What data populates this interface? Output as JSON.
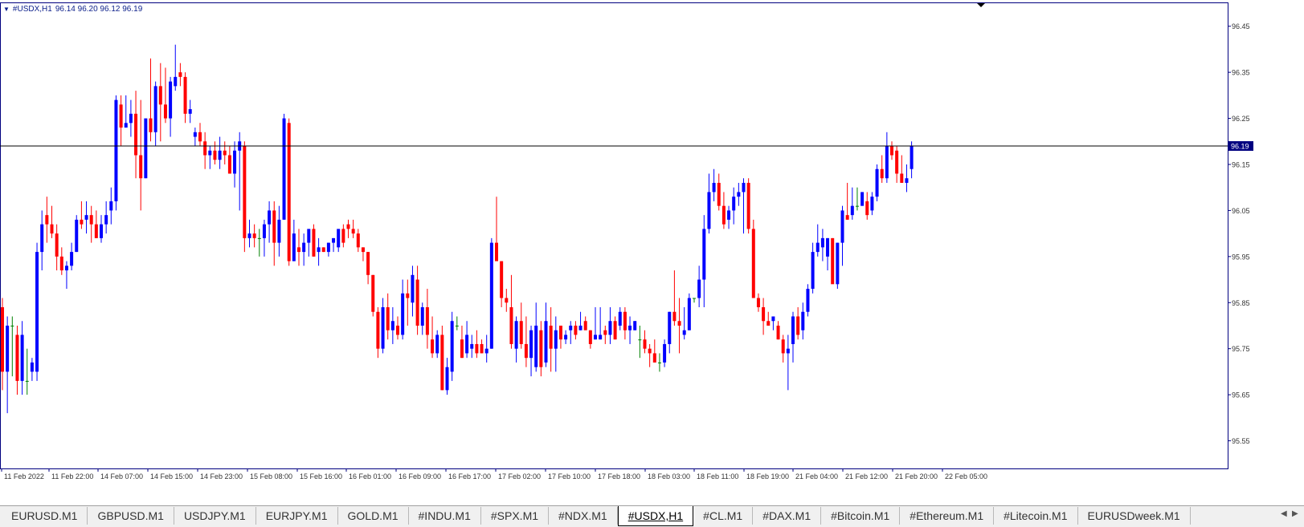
{
  "header": {
    "symbol": "#USDX,H1",
    "ohlc": "96.14 96.20 96.12 96.19"
  },
  "colors": {
    "bull": "#0000ff",
    "bear": "#ff0000",
    "doji": "#008000",
    "axis": "#000080",
    "current_price_line": "#000000"
  },
  "chart_data": {
    "type": "candlestick",
    "y_axis": {
      "range": [
        95.49,
        96.5
      ],
      "ticks": [
        "96.45",
        "96.35",
        "96.25",
        "96.15",
        "96.05",
        "95.95",
        "95.85",
        "95.75",
        "95.65",
        "95.55"
      ]
    },
    "current_price": "96.19",
    "x_labels": [
      "11 Feb 2022",
      "11 Feb 22:00",
      "14 Feb 07:00",
      "14 Feb 15:00",
      "14 Feb 23:00",
      "15 Feb 08:00",
      "15 Feb 16:00",
      "16 Feb 01:00",
      "16 Feb 09:00",
      "16 Feb 17:00",
      "17 Feb 02:00",
      "17 Feb 10:00",
      "17 Feb 18:00",
      "18 Feb 03:00",
      "18 Feb 11:00",
      "18 Feb 19:00",
      "21 Feb 04:00",
      "21 Feb 12:00",
      "21 Feb 20:00",
      "22 Feb 05:00"
    ],
    "candles": [
      [
        95.84,
        95.86,
        95.66,
        95.7
      ],
      [
        95.7,
        95.82,
        95.61,
        95.8
      ],
      [
        95.8,
        95.82,
        95.69,
        95.8
      ],
      [
        95.78,
        95.8,
        95.65,
        95.68
      ],
      [
        95.68,
        95.81,
        95.65,
        95.78
      ],
      [
        95.68,
        95.75,
        95.65,
        95.68
      ],
      [
        95.7,
        95.73,
        95.68,
        95.72
      ],
      [
        95.7,
        95.98,
        95.68,
        95.96
      ],
      [
        95.96,
        96.05,
        95.92,
        96.02
      ],
      [
        96.04,
        96.08,
        95.98,
        96.02
      ],
      [
        96.02,
        96.06,
        95.99,
        96.0
      ],
      [
        96.0,
        96.02,
        95.92,
        95.95
      ],
      [
        95.95,
        95.97,
        95.91,
        95.92
      ],
      [
        95.92,
        95.94,
        95.88,
        95.93
      ],
      [
        95.93,
        95.98,
        95.92,
        95.96
      ],
      [
        95.96,
        96.04,
        95.96,
        96.03
      ],
      [
        96.03,
        96.07,
        96.01,
        96.02
      ],
      [
        96.03,
        96.07,
        96.0,
        96.04
      ],
      [
        96.04,
        96.06,
        95.98,
        96.02
      ],
      [
        96.02,
        96.05,
        95.99,
        95.99
      ],
      [
        95.99,
        96.04,
        95.98,
        96.02
      ],
      [
        96.02,
        96.07,
        96.0,
        96.04
      ],
      [
        96.05,
        96.1,
        96.02,
        96.07
      ],
      [
        96.07,
        96.3,
        96.05,
        96.29
      ],
      [
        96.28,
        96.3,
        96.19,
        96.23
      ],
      [
        96.23,
        96.3,
        96.23,
        96.24
      ],
      [
        96.24,
        96.29,
        96.21,
        96.26
      ],
      [
        96.26,
        96.31,
        96.12,
        96.17
      ],
      [
        96.17,
        96.29,
        96.05,
        96.12
      ],
      [
        96.12,
        96.24,
        96.12,
        96.25
      ],
      [
        96.25,
        96.38,
        96.2,
        96.22
      ],
      [
        96.22,
        96.33,
        96.19,
        96.32
      ],
      [
        96.32,
        96.37,
        96.2,
        96.28
      ],
      [
        96.28,
        96.36,
        96.24,
        96.25
      ],
      [
        96.25,
        96.34,
        96.21,
        96.33
      ],
      [
        96.32,
        96.41,
        96.31,
        96.34
      ],
      [
        96.35,
        96.37,
        96.32,
        96.34
      ],
      [
        96.34,
        96.35,
        96.24,
        96.26
      ],
      [
        96.26,
        96.29,
        96.24,
        96.27
      ],
      [
        96.21,
        96.23,
        96.19,
        96.22
      ],
      [
        96.22,
        96.24,
        96.19,
        96.2
      ],
      [
        96.2,
        96.22,
        96.14,
        96.17
      ],
      [
        96.17,
        96.19,
        96.14,
        96.18
      ],
      [
        96.18,
        96.2,
        96.15,
        96.16
      ],
      [
        96.16,
        96.21,
        96.14,
        96.18
      ],
      [
        96.18,
        96.2,
        96.15,
        96.17
      ],
      [
        96.17,
        96.19,
        96.13,
        96.13
      ],
      [
        96.13,
        96.2,
        96.1,
        96.18
      ],
      [
        96.18,
        96.22,
        96.05,
        96.2
      ],
      [
        96.19,
        96.2,
        95.96,
        95.99
      ],
      [
        95.99,
        96.03,
        95.97,
        96.0
      ],
      [
        96.0,
        96.02,
        95.97,
        95.99
      ],
      [
        95.99,
        96.01,
        95.95,
        95.99
      ],
      [
        95.99,
        96.03,
        95.95,
        96.02
      ],
      [
        96.02,
        96.07,
        95.98,
        96.05
      ],
      [
        96.05,
        96.07,
        95.93,
        95.98
      ],
      [
        95.98,
        96.06,
        95.95,
        96.03
      ],
      [
        96.03,
        96.26,
        96.03,
        96.25
      ],
      [
        96.24,
        96.25,
        95.93,
        95.94
      ],
      [
        95.94,
        96.03,
        95.94,
        96.0
      ],
      [
        95.97,
        96.01,
        95.93,
        95.96
      ],
      [
        95.96,
        96.0,
        95.93,
        95.98
      ],
      [
        95.98,
        96.0,
        95.95,
        96.01
      ],
      [
        96.01,
        96.02,
        95.95,
        95.95
      ],
      [
        95.96,
        95.99,
        95.93,
        95.97
      ],
      [
        95.97,
        95.97,
        95.96,
        95.96
      ],
      [
        95.96,
        95.98,
        95.95,
        95.98
      ],
      [
        95.98,
        95.99,
        95.96,
        95.99
      ],
      [
        95.97,
        96.0,
        95.96,
        96.01
      ],
      [
        96.01,
        96.02,
        95.97,
        95.98
      ],
      [
        96.02,
        96.03,
        95.99,
        96.01
      ],
      [
        96.01,
        96.03,
        95.99,
        96.0
      ],
      [
        96.0,
        96.01,
        95.96,
        95.97
      ],
      [
        95.97,
        95.97,
        95.94,
        95.96
      ],
      [
        95.96,
        95.96,
        95.89,
        95.91
      ],
      [
        95.91,
        95.91,
        95.82,
        95.83
      ],
      [
        95.83,
        95.84,
        95.73,
        95.75
      ],
      [
        95.75,
        95.86,
        95.74,
        95.84
      ],
      [
        95.84,
        95.87,
        95.77,
        95.79
      ],
      [
        95.79,
        95.84,
        95.76,
        95.81
      ],
      [
        95.8,
        95.82,
        95.77,
        95.78
      ],
      [
        95.78,
        95.9,
        95.77,
        95.87
      ],
      [
        95.87,
        95.9,
        95.8,
        95.86
      ],
      [
        95.85,
        95.93,
        95.82,
        95.91
      ],
      [
        95.9,
        95.93,
        95.78,
        95.8
      ],
      [
        95.8,
        95.85,
        95.78,
        95.84
      ],
      [
        95.84,
        95.88,
        95.75,
        95.78
      ],
      [
        95.77,
        95.82,
        95.73,
        95.74
      ],
      [
        95.74,
        95.79,
        95.73,
        95.78
      ],
      [
        95.78,
        95.8,
        95.66,
        95.66
      ],
      [
        95.66,
        95.73,
        95.65,
        95.71
      ],
      [
        95.7,
        95.83,
        95.68,
        95.81
      ],
      [
        95.8,
        95.82,
        95.79,
        95.8
      ],
      [
        95.77,
        95.8,
        95.73,
        95.73
      ],
      [
        95.74,
        95.81,
        95.73,
        95.78
      ],
      [
        95.75,
        95.78,
        95.73,
        95.76
      ],
      [
        95.76,
        95.79,
        95.73,
        95.74
      ],
      [
        95.76,
        95.77,
        95.74,
        95.74
      ],
      [
        95.74,
        95.78,
        95.72,
        95.75
      ],
      [
        95.75,
        95.99,
        95.75,
        95.98
      ],
      [
        95.98,
        96.08,
        95.97,
        95.94
      ],
      [
        95.94,
        95.94,
        95.84,
        95.86
      ],
      [
        95.86,
        95.88,
        95.83,
        95.85
      ],
      [
        95.84,
        95.91,
        95.75,
        95.76
      ],
      [
        95.75,
        95.82,
        95.72,
        95.81
      ],
      [
        95.81,
        95.85,
        95.75,
        95.76
      ],
      [
        95.76,
        95.82,
        95.71,
        95.73
      ],
      [
        95.73,
        95.8,
        95.69,
        95.79
      ],
      [
        95.71,
        95.85,
        95.7,
        95.8
      ],
      [
        95.79,
        95.81,
        95.69,
        95.71
      ],
      [
        95.72,
        95.85,
        95.71,
        95.81
      ],
      [
        95.8,
        95.84,
        95.7,
        95.75
      ],
      [
        95.75,
        95.82,
        95.7,
        95.79
      ],
      [
        95.8,
        95.8,
        95.75,
        95.77
      ],
      [
        95.77,
        95.79,
        95.76,
        95.78
      ],
      [
        95.79,
        95.81,
        95.76,
        95.8
      ],
      [
        95.8,
        95.81,
        95.77,
        95.78
      ],
      [
        95.79,
        95.83,
        95.79,
        95.8
      ],
      [
        95.81,
        95.82,
        95.8,
        95.79
      ],
      [
        95.79,
        95.79,
        95.75,
        95.76
      ],
      [
        95.77,
        95.84,
        95.77,
        95.78
      ],
      [
        95.77,
        95.84,
        95.77,
        95.78
      ],
      [
        95.79,
        95.8,
        95.76,
        95.78
      ],
      [
        95.78,
        95.84,
        95.76,
        95.81
      ],
      [
        95.81,
        95.82,
        95.77,
        95.77
      ],
      [
        95.8,
        95.84,
        95.79,
        95.83
      ],
      [
        95.83,
        95.84,
        95.77,
        95.79
      ],
      [
        95.79,
        95.82,
        95.76,
        95.8
      ],
      [
        95.79,
        95.81,
        95.79,
        95.81
      ],
      [
        95.77,
        95.8,
        95.73,
        95.77
      ],
      [
        95.77,
        95.79,
        95.74,
        95.75
      ],
      [
        95.75,
        95.76,
        95.71,
        95.74
      ],
      [
        95.74,
        95.77,
        95.72,
        95.72
      ],
      [
        95.72,
        95.74,
        95.7,
        95.72
      ],
      [
        95.72,
        95.77,
        95.71,
        95.76
      ],
      [
        95.76,
        95.83,
        95.74,
        95.83
      ],
      [
        95.83,
        95.92,
        95.8,
        95.81
      ],
      [
        95.81,
        95.86,
        95.74,
        95.8
      ],
      [
        95.78,
        95.84,
        95.77,
        95.79
      ],
      [
        95.79,
        95.87,
        95.79,
        95.86
      ],
      [
        95.86,
        95.86,
        95.85,
        95.86
      ],
      [
        95.86,
        95.93,
        95.84,
        95.9
      ],
      [
        95.9,
        96.04,
        95.84,
        96.01
      ],
      [
        96.01,
        96.13,
        96.0,
        96.09
      ],
      [
        96.09,
        96.14,
        96.07,
        96.11
      ],
      [
        96.11,
        96.13,
        96.05,
        96.06
      ],
      [
        96.06,
        96.09,
        96.01,
        96.02
      ],
      [
        96.03,
        96.06,
        96.01,
        96.05
      ],
      [
        96.05,
        96.1,
        96.02,
        96.08
      ],
      [
        96.08,
        96.11,
        96.06,
        96.09
      ],
      [
        96.09,
        96.12,
        96.0,
        96.11
      ],
      [
        96.11,
        96.12,
        96.0,
        96.01
      ],
      [
        96.01,
        96.03,
        95.86,
        95.86
      ],
      [
        95.86,
        95.87,
        95.83,
        95.84
      ],
      [
        95.84,
        95.86,
        95.78,
        95.81
      ],
      [
        95.81,
        95.83,
        95.8,
        95.8
      ],
      [
        95.81,
        95.82,
        95.79,
        95.82
      ],
      [
        95.8,
        95.81,
        95.77,
        95.77
      ],
      [
        95.77,
        95.78,
        95.72,
        95.74
      ],
      [
        95.74,
        95.78,
        95.66,
        95.75
      ],
      [
        95.76,
        95.83,
        95.72,
        95.82
      ],
      [
        95.82,
        95.84,
        95.77,
        95.78
      ],
      [
        95.79,
        95.85,
        95.77,
        95.83
      ],
      [
        95.83,
        95.89,
        95.82,
        95.88
      ],
      [
        95.88,
        95.98,
        95.87,
        95.96
      ],
      [
        95.96,
        96.02,
        95.95,
        95.98
      ],
      [
        95.97,
        96.01,
        95.94,
        95.99
      ],
      [
        95.95,
        95.99,
        95.92,
        95.99
      ],
      [
        95.99,
        95.99,
        95.91,
        95.89
      ],
      [
        95.89,
        95.98,
        95.88,
        95.98
      ],
      [
        95.98,
        96.06,
        95.93,
        96.05
      ],
      [
        96.04,
        96.11,
        96.03,
        96.03
      ],
      [
        96.04,
        96.1,
        96.03,
        96.06
      ],
      [
        96.06,
        96.1,
        96.05,
        96.06
      ],
      [
        96.06,
        96.09,
        96.07,
        96.09
      ],
      [
        96.07,
        96.09,
        96.03,
        96.04
      ],
      [
        96.05,
        96.09,
        96.04,
        96.08
      ],
      [
        96.08,
        96.15,
        96.07,
        96.14
      ],
      [
        96.14,
        96.17,
        96.11,
        96.12
      ],
      [
        96.12,
        96.22,
        96.11,
        96.19
      ],
      [
        96.19,
        96.2,
        96.16,
        96.17
      ],
      [
        96.18,
        96.19,
        96.11,
        96.13
      ],
      [
        96.13,
        96.17,
        96.11,
        96.11
      ],
      [
        96.11,
        96.15,
        96.09,
        96.12
      ],
      [
        96.14,
        96.2,
        96.12,
        96.19
      ]
    ]
  },
  "tabs": [
    {
      "label": "EURUSD.M1"
    },
    {
      "label": "GBPUSD.M1"
    },
    {
      "label": "USDJPY.M1"
    },
    {
      "label": "EURJPY.M1"
    },
    {
      "label": "GOLD.M1"
    },
    {
      "label": "#INDU.M1"
    },
    {
      "label": "#SPX.M1"
    },
    {
      "label": "#NDX.M1"
    },
    {
      "label": "#USDX,H1"
    },
    {
      "label": "#CL.M1"
    },
    {
      "label": "#DAX.M1"
    },
    {
      "label": "#Bitcoin.M1"
    },
    {
      "label": "#Ethereum.M1"
    },
    {
      "label": "#Litecoin.M1"
    },
    {
      "label": "EURUSDweek.M1"
    }
  ],
  "active_tab_index": 8
}
